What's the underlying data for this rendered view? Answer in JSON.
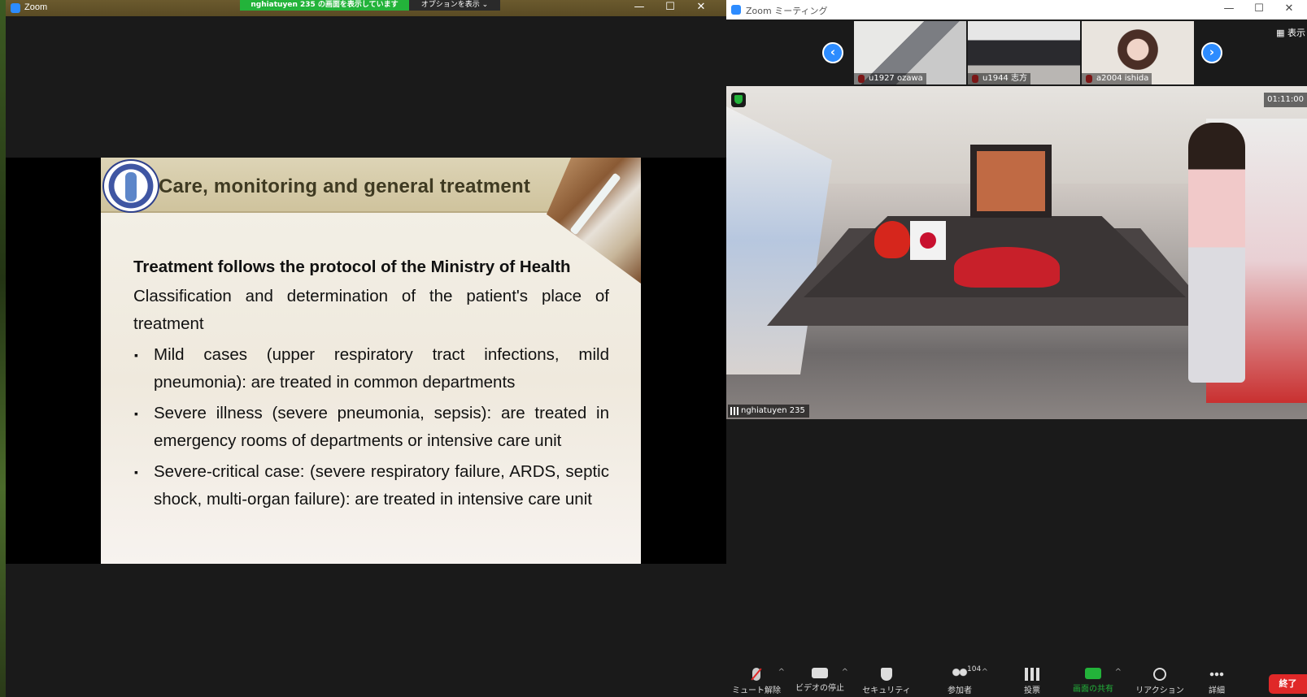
{
  "share_window": {
    "app_name": "Zoom",
    "banner": "nghiatuyen 235 の画面を表示しています",
    "view_options": "オプションを表示 ⌄",
    "controls": {
      "minimize": "—",
      "maximize": "☐",
      "close": "✕"
    }
  },
  "slide": {
    "title": "Care, monitoring and general treatment",
    "heading": "Treatment follows the protocol of the Ministry of Health",
    "intro": "Classification and determination of the patient's place of treatment",
    "bullets": [
      "Mild cases (upper respiratory tract infections, mild pneumonia): are treated in common departments",
      "Severe illness (severe pneumonia, sepsis): are treated in emergency rooms of departments or intensive care unit",
      "Severe-critical case: (severe respiratory failure, ARDS, septic shock, multi-organ failure): are treated in intensive care unit"
    ],
    "bullet_marker": "▪"
  },
  "meeting_window": {
    "app_name": "Zoom ミーティング",
    "controls": {
      "minimize": "—",
      "maximize": "☐",
      "close": "✕"
    },
    "view_button": "▦ 表示",
    "gallery": {
      "prev": "‹",
      "next": "›",
      "participants": [
        {
          "name": "u1927 ozawa"
        },
        {
          "name": "u1944 志方"
        },
        {
          "name": "a2004 ishida"
        }
      ]
    },
    "main_video": {
      "speaker": "nghiatuyen 235",
      "timer": "01:11:00"
    },
    "toolbar": {
      "mute": "ミュート解除",
      "video": "ビデオの停止",
      "security": "セキュリティ",
      "participants": "参加者",
      "participants_count": "104",
      "polls": "投票",
      "share": "画面の共有",
      "reactions": "リアクション",
      "more": "詳細",
      "end": "終了",
      "caret": "^"
    }
  },
  "colors": {
    "zoom_blue": "#2d8cff",
    "share_green": "#23b33a",
    "end_red": "#e02828",
    "slide_title": "#3f3a22"
  }
}
